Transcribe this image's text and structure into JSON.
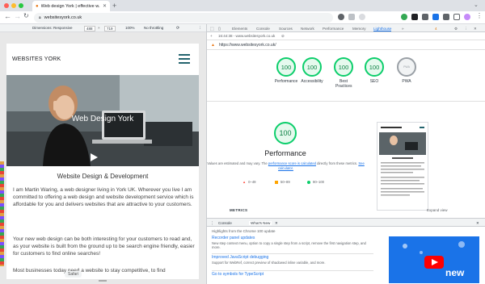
{
  "browser": {
    "tab_title": "Web design York | effective w...",
    "new_tab": "+",
    "url": "websitesyork.co.uk"
  },
  "device_toolbar": {
    "dimensions_label": "Dimensions: Responsive",
    "width": "488",
    "height": "719",
    "zoom": "100%",
    "throttle": "No throttling"
  },
  "site": {
    "title": "WEBSITES YORK",
    "hero_text": "Web Design York",
    "subtitle": "Website Design & Development",
    "paragraphs": [
      "I am Martin Waring, a web designer living in York UK. Wherever you live I am committed to offering a web design and website development service which is affordable for you and delivers websites that are attractive to your customers.",
      "Your new web design can be both interesting for your customers to read and, as your website is built from the ground up to be search engine friendly, easier for customers to find online searches!",
      "Most businesses today need a website to stay competitive, to find"
    ],
    "safari_label": "Safari"
  },
  "devtools": {
    "tabs": [
      "Elements",
      "Console",
      "Sources",
      "Network",
      "Performance",
      "Memory",
      "Lighthouse",
      "»"
    ],
    "active_tab": "Lighthouse",
    "badge": "4",
    "subbar_time": "16:44:38 - www.websitesyork.co.uk",
    "report_url": "https://www.websitesyork.co.uk/",
    "scores": [
      {
        "label": "Performance",
        "value": "100"
      },
      {
        "label": "Accessibility",
        "value": "100"
      },
      {
        "label": "Best Practices",
        "value": "100"
      },
      {
        "label": "SEO",
        "value": "100"
      }
    ],
    "pwa": {
      "label": "PWA",
      "value": "PWA"
    },
    "perf": {
      "score": "100",
      "title": "Performance",
      "note_prefix": "Values are estimated and may vary. The ",
      "note_link": "performance score is calculated",
      "note_mid": " directly from these metrics. ",
      "note_link2": "See calculator.",
      "legend": [
        "0–49",
        "50–89",
        "90–100"
      ]
    },
    "metrics_label": "METRICS",
    "expand_label": "Expand view",
    "drawer": {
      "tabs": [
        "Console",
        "What's New"
      ],
      "highlights": "Highlights from the Chrome 100 update",
      "items": [
        {
          "title": "Recorder panel updates",
          "desc": "New step context menu, option to copy a single step from a script, remove the first navigation step, and more."
        },
        {
          "title": "Improved JavaScript debugging",
          "desc": "Support for WebRef, correct preview of shadowed inline variable, and more."
        },
        {
          "title": "Go to symbols for TypeScript",
          "desc": ""
        }
      ],
      "video_label": "new"
    }
  },
  "colors": {
    "accent_green": "#0cce6b",
    "link_blue": "#1a73e8",
    "hamburger": "#24646e"
  }
}
